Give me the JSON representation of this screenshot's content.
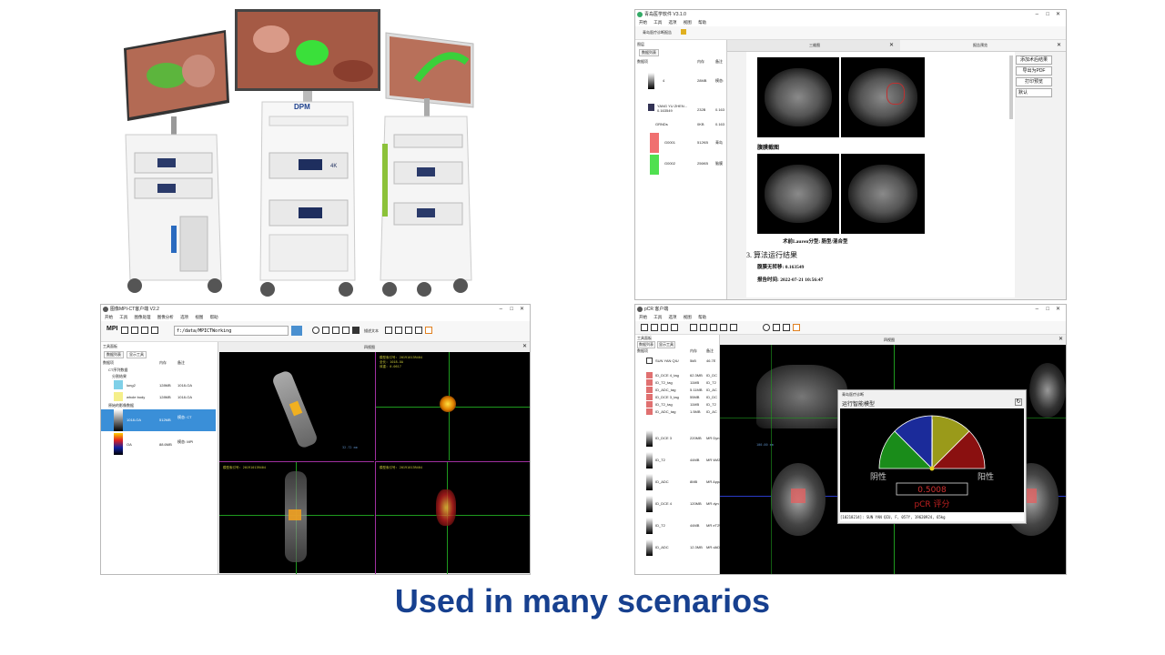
{
  "caption": "Used in many scenarios",
  "photo": {
    "brand": "DPM",
    "badge": "4K"
  },
  "win_report": {
    "title": "青岛医学软件 V3.1.0",
    "menu": [
      "开始",
      "工具",
      "选项",
      "视图",
      "帮助"
    ],
    "toolbar_label": "青岛医疗诊断报告",
    "left_panel_title": "图层",
    "left_tab": "数据列表",
    "columns": [
      "数据项",
      "内存",
      "备注"
    ],
    "tree": [
      {
        "label": "4",
        "size": "28MB",
        "note": "模态:"
      },
      {
        "label": "YANG YU ZHEN... 0.163549",
        "size": "232B",
        "note": "0.163"
      },
      {
        "label": "GRNDs",
        "size": "0KB",
        "note": "0.163"
      },
      {
        "label": "G0001",
        "size": "512KB",
        "note": "青岛"
      },
      {
        "label": "G0002",
        "size": "256KB",
        "note": "脑膜"
      }
    ],
    "tab_left": "三维图",
    "tab_right": "报告预览",
    "caption_top": "腹膜截图",
    "caption_mid": "术前Lauren分型: 肠型/混合型",
    "section": "3. 算法运行结果",
    "result_line": "腹膜无转移: 0.163549",
    "report_time": "报告时间: 2022-07-21 10:56:47",
    "buttons": [
      "添加术后结果",
      "导出为PDF",
      "打印预览",
      "默认"
    ]
  },
  "win_ct": {
    "title": "图像MPI-CT客户端 V2.2",
    "menu": [
      "开始",
      "工具",
      "图像处理",
      "图像分析",
      "选项",
      "视图",
      "帮助"
    ],
    "logo": "MPI",
    "path": "f:/data/MPICTWorking",
    "toolbar_text": "描述文本",
    "left_panel_title": "工具面板",
    "tabs": [
      "数据列表",
      "显示工具"
    ],
    "columns": [
      "数据项",
      "内存",
      "备注"
    ],
    "group1": "CT序列数据",
    "group2": "分割结果",
    "group3": "原始的影像数据",
    "items": [
      {
        "label": "lung2",
        "size": "128MB",
        "note": "1018-OA"
      },
      {
        "label": "whole body",
        "size": "128MB",
        "note": "1018-OA"
      },
      {
        "label": "1018-OA",
        "size": "512MB",
        "note": "模态: CT"
      },
      {
        "label": "OA",
        "size": "88.6MB",
        "note": "模态: MPI"
      }
    ],
    "view_title": "四视图",
    "scale_label": "32.72 mm",
    "overlay_lines": [
      "模型索引号: 20191013R404",
      "全长: 1018-OA",
      "体重: 0.0617"
    ]
  },
  "win_pcr": {
    "title": "pCR 客户端",
    "menu": [
      "开始",
      "工具",
      "选项",
      "视图",
      "帮助"
    ],
    "left_panel_title": "工具面板",
    "tabs": [
      "数据列表",
      "显示工具"
    ],
    "columns": [
      "数据项",
      "内存",
      "备注"
    ],
    "items": [
      {
        "label": "SUN YAN QIU",
        "size": "5kB",
        "note": "46.7E"
      },
      {
        "label": "ID_DCE 4_tag",
        "size": "62.3MB",
        "note": "ID_DC"
      },
      {
        "label": "ID_T2_tag",
        "size": "11MB",
        "note": "ID_T2"
      },
      {
        "label": "ID_ADC_tag",
        "size": "5.11MB",
        "note": "ID_AC"
      },
      {
        "label": "ID_DCE 3_tag",
        "size": "55MB",
        "note": "ID_DC"
      },
      {
        "label": "ID_T2_tag",
        "size": "11MB",
        "note": "ID_T2"
      },
      {
        "label": "ID_ADC_tag",
        "size": "1.5MB",
        "note": "ID_AC"
      },
      {
        "label": "ID_DCE 3",
        "size": "220MB",
        "note": "MR Dyn"
      },
      {
        "label": "ID_T2",
        "size": "44MB",
        "note": "MR WATE"
      },
      {
        "label": "ID_ADC",
        "size": "8MB",
        "note": "MR Appa"
      },
      {
        "label": "ID_DCE 4",
        "size": "120MB",
        "note": "MR dyn"
      },
      {
        "label": "ID_T2",
        "size": "44MB",
        "note": "MR eT2W"
      },
      {
        "label": "ID_ADC",
        "size": "12.3MB",
        "note": "MR dADC"
      }
    ],
    "view_title": "四视图",
    "scale": "100.00 mm",
    "dialog_title": "青岛医疗诊断",
    "dialog_subtitle": "运行智能模型",
    "gauge_left": "阴性",
    "gauge_right": "阳性",
    "gauge_value": "0.5008",
    "gauge_label": "pCR 评分",
    "footer": "[10218214]: SUN YAN QIU, F, 057Y, 19620924, 65kg",
    "gauge_colors": [
      "#1a8c1a",
      "#1b2b9a",
      "#9a9a1a",
      "#8a1010"
    ],
    "gauge_fraction": 0.5008
  }
}
